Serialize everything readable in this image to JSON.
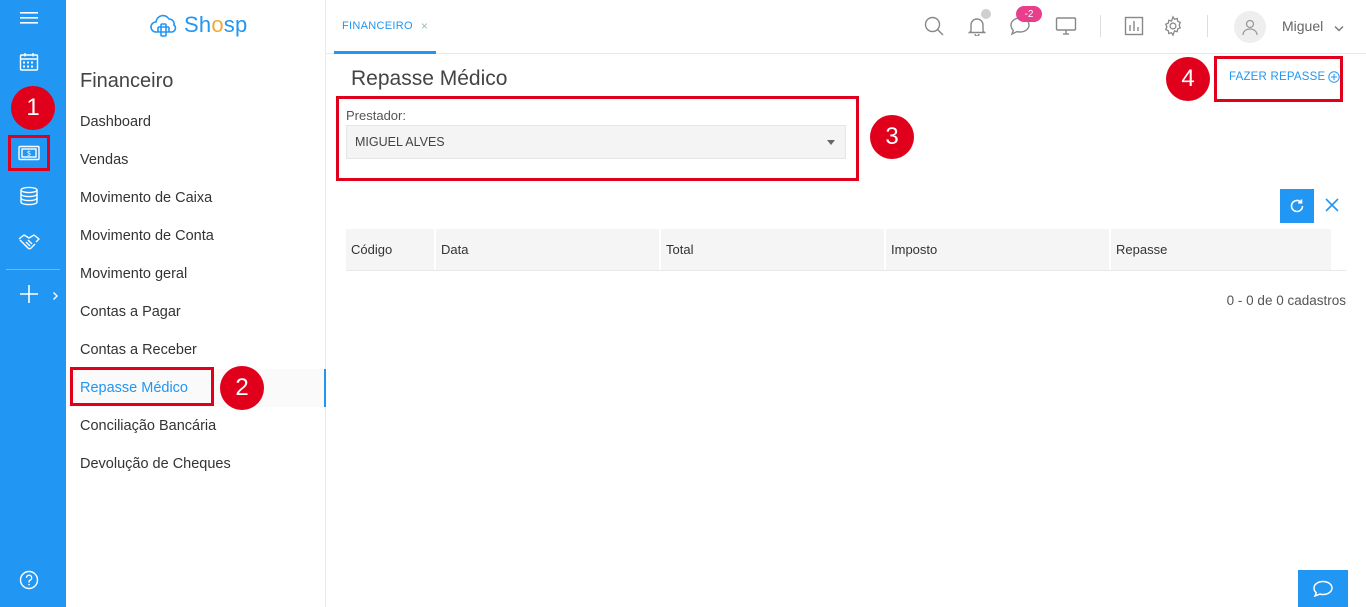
{
  "app": {
    "brand_pre": "Sh",
    "brand_o": "o",
    "brand_post": "sp"
  },
  "rail": {
    "icons": [
      "hamburger-menu-icon",
      "calendar-icon",
      "money-icon",
      "database-icon",
      "handshake-icon",
      "plus-icon",
      "chevron-right-icon",
      "help-icon"
    ]
  },
  "sidebar": {
    "title": "Financeiro",
    "items": [
      {
        "label": "Dashboard"
      },
      {
        "label": "Vendas"
      },
      {
        "label": "Movimento de Caixa"
      },
      {
        "label": "Movimento de Conta"
      },
      {
        "label": "Movimento geral"
      },
      {
        "label": "Contas a Pagar"
      },
      {
        "label": "Contas a Receber"
      },
      {
        "label": "Repasse Médico"
      },
      {
        "label": "Conciliação Bancária"
      },
      {
        "label": "Devolução de Cheques"
      }
    ],
    "active_index": 7
  },
  "header": {
    "tab_label": "FINANCEIRO",
    "tab_close": "×",
    "chat_badge": "-2",
    "username": "Miguel"
  },
  "main": {
    "title": "Repasse Médico",
    "action_label": "FAZER REPASSE",
    "prestador_label": "Prestador:",
    "prestador_value": "MIGUEL ALVES",
    "columns": [
      "Código",
      "Data",
      "Total",
      "Imposto",
      "Repasse"
    ],
    "pager_text": "0 - 0 de 0 cadastros"
  },
  "annotations": [
    "1",
    "2",
    "3",
    "4"
  ],
  "colors": {
    "primary": "#2196f3",
    "annotation": "#e0001b",
    "badge": "#e83e8c"
  }
}
